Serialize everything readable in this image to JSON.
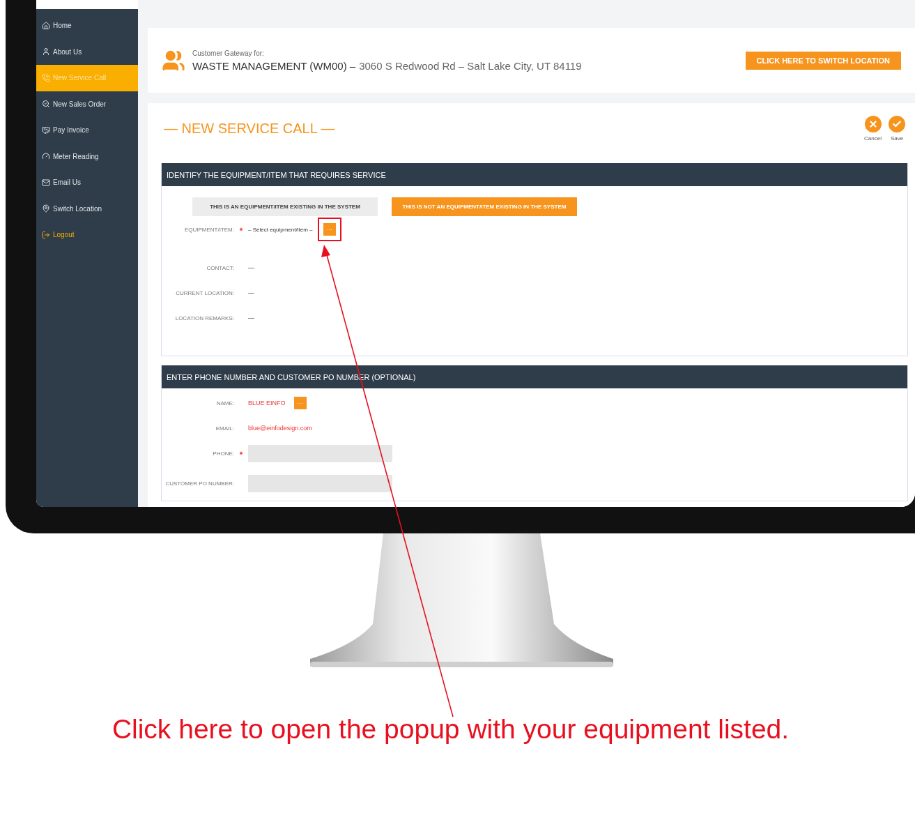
{
  "sidebar": {
    "items": [
      {
        "label": "Home",
        "kind": "link",
        "selected": false
      },
      {
        "label": "About Us",
        "kind": "link",
        "selected": false
      },
      {
        "label": "New Service Call",
        "kind": "link",
        "selected": true
      },
      {
        "label": "New Sales Order",
        "kind": "link",
        "selected": false
      },
      {
        "label": "Pay Invoice",
        "kind": "link",
        "selected": false
      },
      {
        "label": "Meter Reading",
        "kind": "link",
        "selected": false
      },
      {
        "label": "Email Us",
        "kind": "link",
        "selected": false
      },
      {
        "label": "Switch Location",
        "kind": "link",
        "selected": false
      },
      {
        "label": "Logout",
        "kind": "logout",
        "selected": false
      }
    ]
  },
  "gateway": {
    "caption": "Customer Gateway for:",
    "customer": "WASTE MANAGEMENT (WM00) –",
    "address": "3060 S Redwood Rd – Salt Lake City, UT 84119",
    "switch_button": "CLICK HERE TO SWITCH LOCATION"
  },
  "service_call": {
    "title": "— NEW SERVICE CALL —",
    "actions": [
      {
        "kind": "cancel",
        "label": "Cancel"
      },
      {
        "kind": "save",
        "label": "Save"
      }
    ],
    "sections": [
      {
        "header": "IDENTIFY THE EQUIPMENT/ITEM THAT REQUIRES SERVICE",
        "toggle": [
          {
            "label": "THIS IS AN EQUIPMENT/ITEM EXISTING IN THE SYSTEM",
            "selected": false
          },
          {
            "label": "THIS IS NOT AN EQUIPMENT/ITEM EXISTING IN THE SYSTEM",
            "selected": true
          }
        ],
        "fields": [
          {
            "kind": "picker",
            "label": "EQUIPMENT/ITEM:",
            "required": true,
            "value": "– Select equipment/item –",
            "button": "···"
          },
          {
            "kind": "text",
            "label": "CONTACT:",
            "required": false,
            "value": "—"
          },
          {
            "kind": "text",
            "label": "CURRENT LOCATION:",
            "required": false,
            "value": "—"
          },
          {
            "kind": "text",
            "label": "LOCATION REMARKS:",
            "required": false,
            "value": "—"
          }
        ]
      },
      {
        "header": "ENTER PHONE NUMBER AND CUSTOMER PO NUMBER (OPTIONAL)",
        "fields": [
          {
            "kind": "picker",
            "label": "NAME:",
            "required": false,
            "value": "BLUE EINFO",
            "button": "···"
          },
          {
            "kind": "text",
            "label": "EMAIL:",
            "required": false,
            "value": "blue@einfodesign.com"
          },
          {
            "kind": "input",
            "label": "PHONE:",
            "required": true
          },
          {
            "kind": "input",
            "label": "CUSTOMER PO NUMBER:",
            "required": false
          }
        ]
      }
    ]
  },
  "annotation": {
    "caption": "Click here to open the popup with your equipment listed."
  }
}
